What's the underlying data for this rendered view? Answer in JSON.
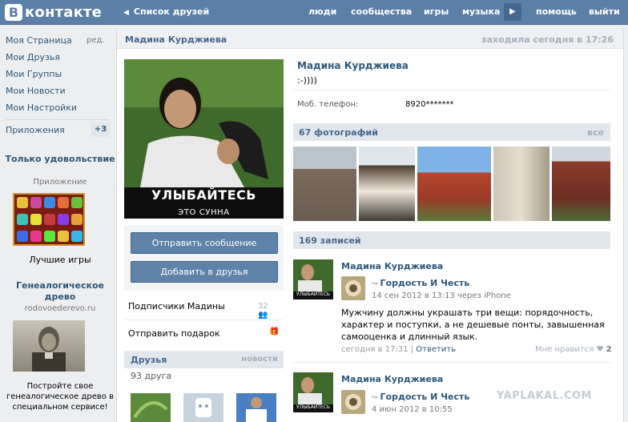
{
  "header": {
    "logo_text": "контакте",
    "logo_letter": "В",
    "back_label": "Список друзей",
    "nav": [
      "люди",
      "сообщества",
      "игры",
      "музыка",
      "помощь",
      "выйти"
    ]
  },
  "left_menu": {
    "items": [
      "Моя Страница",
      "Мои Друзья",
      "Мои Группы",
      "Мои Новости",
      "Мои Настройки"
    ],
    "edit_label": "ред.",
    "apps_label": "Приложения",
    "apps_badge": "+3"
  },
  "ads": [
    {
      "title": "Только удовольствие",
      "subtitle": "Приложение",
      "caption": "Лучшие игры"
    },
    {
      "title": "Генеалогическое древо",
      "subtitle": "rodovoederevo.ru",
      "caption": "Постройте свое генеалогическое древо в специальном сервисе!"
    }
  ],
  "profile": {
    "header_name": "Мадина Курджиева",
    "last_seen": "заходила сегодня в 17:26",
    "name": "Мадина Курджиева",
    "status": ":-))))",
    "avatar_caption_1": "УЛЫБАЙТЕСЬ",
    "avatar_caption_2": "ЭТО СУННА",
    "phone_label": "Моб. телефон:",
    "phone_value": "8920*******"
  },
  "actions": {
    "send_message": "Отправить сообщение",
    "add_friend": "Добавить в друзья",
    "subscribers_label": "Подписчики Мадины",
    "subscribers_count": "32",
    "gift_label": "Отправить подарок"
  },
  "friends": {
    "title": "Друзья",
    "news": "новости",
    "count": "93 друга"
  },
  "photos": {
    "title": "67 фотографий",
    "all": "все"
  },
  "wall": {
    "title": "169 записей",
    "posts": [
      {
        "author": "Мадина Курджиева",
        "avatar_caption": "УЛЫБАЙТЕСЬ",
        "repost_title": "Гордость И Честь",
        "repost_date": "14 сен 2012 в 13:13 через iPhone",
        "text": "Мужчину должны украшать три вещи: порядочность, характер и поступки, а не дешевые понты, завышенная самооценка и длинный язык.",
        "time": "сегодня в 17:31",
        "reply": "Ответить",
        "like_label": "Мне нравится",
        "like_count": "2"
      },
      {
        "author": "Мадина Курджиева",
        "avatar_caption": "УЛЫБАЙТЕСЬ",
        "repost_title": "Гордость И Честь",
        "repost_date": "4 июн 2012 в 10:55"
      }
    ]
  },
  "watermark": "YAPLAKAL.COM",
  "colors": {
    "header_bg": "#5b7fa6",
    "link": "#2b587a",
    "section_bg": "#e1e7ed",
    "button": "#5e82a8"
  }
}
